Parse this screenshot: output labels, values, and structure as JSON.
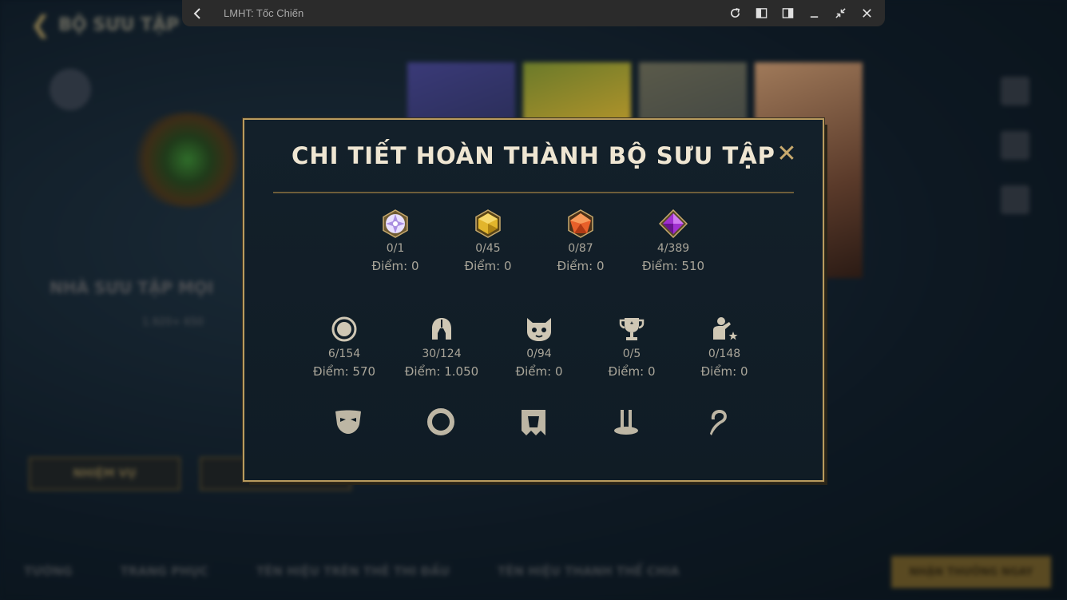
{
  "window": {
    "title": "LMHT: Tốc Chiến"
  },
  "background": {
    "header_title": "BỘ SƯU TẬP",
    "collector_name": "NHÀ SƯU TẬP MỌI",
    "collector_sub": "1.920+ 650",
    "button_left": "NHIỆM VỤ",
    "tabs": [
      "TƯỚNG",
      "TRANG PHỤC",
      "TÊN HIỆU TRÊN THẺ THI ĐẤU",
      "TÊN HIỆU THANH THỂ CHIA"
    ],
    "bottom_button": "NHẬN THƯỞNG NGAY"
  },
  "modal": {
    "title": "CHI TIẾT HOÀN THÀNH BỘ SƯU TẬP",
    "close_label": "✕",
    "gem_row": [
      {
        "icon": "white-gem-icon",
        "count": "0/1",
        "points": "Điểm: 0",
        "color": "#c9b8f0"
      },
      {
        "icon": "gold-gem-icon",
        "count": "0/45",
        "points": "Điểm: 0",
        "color": "#e2b52c"
      },
      {
        "icon": "orange-gem-icon",
        "count": "0/87",
        "points": "Điểm: 0",
        "color": "#e8602a"
      },
      {
        "icon": "purple-gem-icon",
        "count": "4/389",
        "points": "Điểm: 510",
        "color": "#a030d0"
      }
    ],
    "category_row": [
      {
        "icon": "icon-ring-icon",
        "count": "6/154",
        "points": "Điểm: 570"
      },
      {
        "icon": "helmet-icon",
        "count": "30/124",
        "points": "Điểm: 1.050"
      },
      {
        "icon": "poro-icon",
        "count": "0/94",
        "points": "Điểm: 0"
      },
      {
        "icon": "trophy-icon",
        "count": "0/5",
        "points": "Điểm: 0"
      },
      {
        "icon": "emote-person-star-icon",
        "count": "0/148",
        "points": "Điểm: 0"
      }
    ],
    "partial_row": [
      "mask-icon",
      "ring-border-icon",
      "banner-icon",
      "pedestal-icon",
      "recall-icon"
    ]
  },
  "colors": {
    "accent_gold": "#c8aa6e",
    "modal_bg": "#13202a",
    "text_light": "#efe6d2"
  }
}
